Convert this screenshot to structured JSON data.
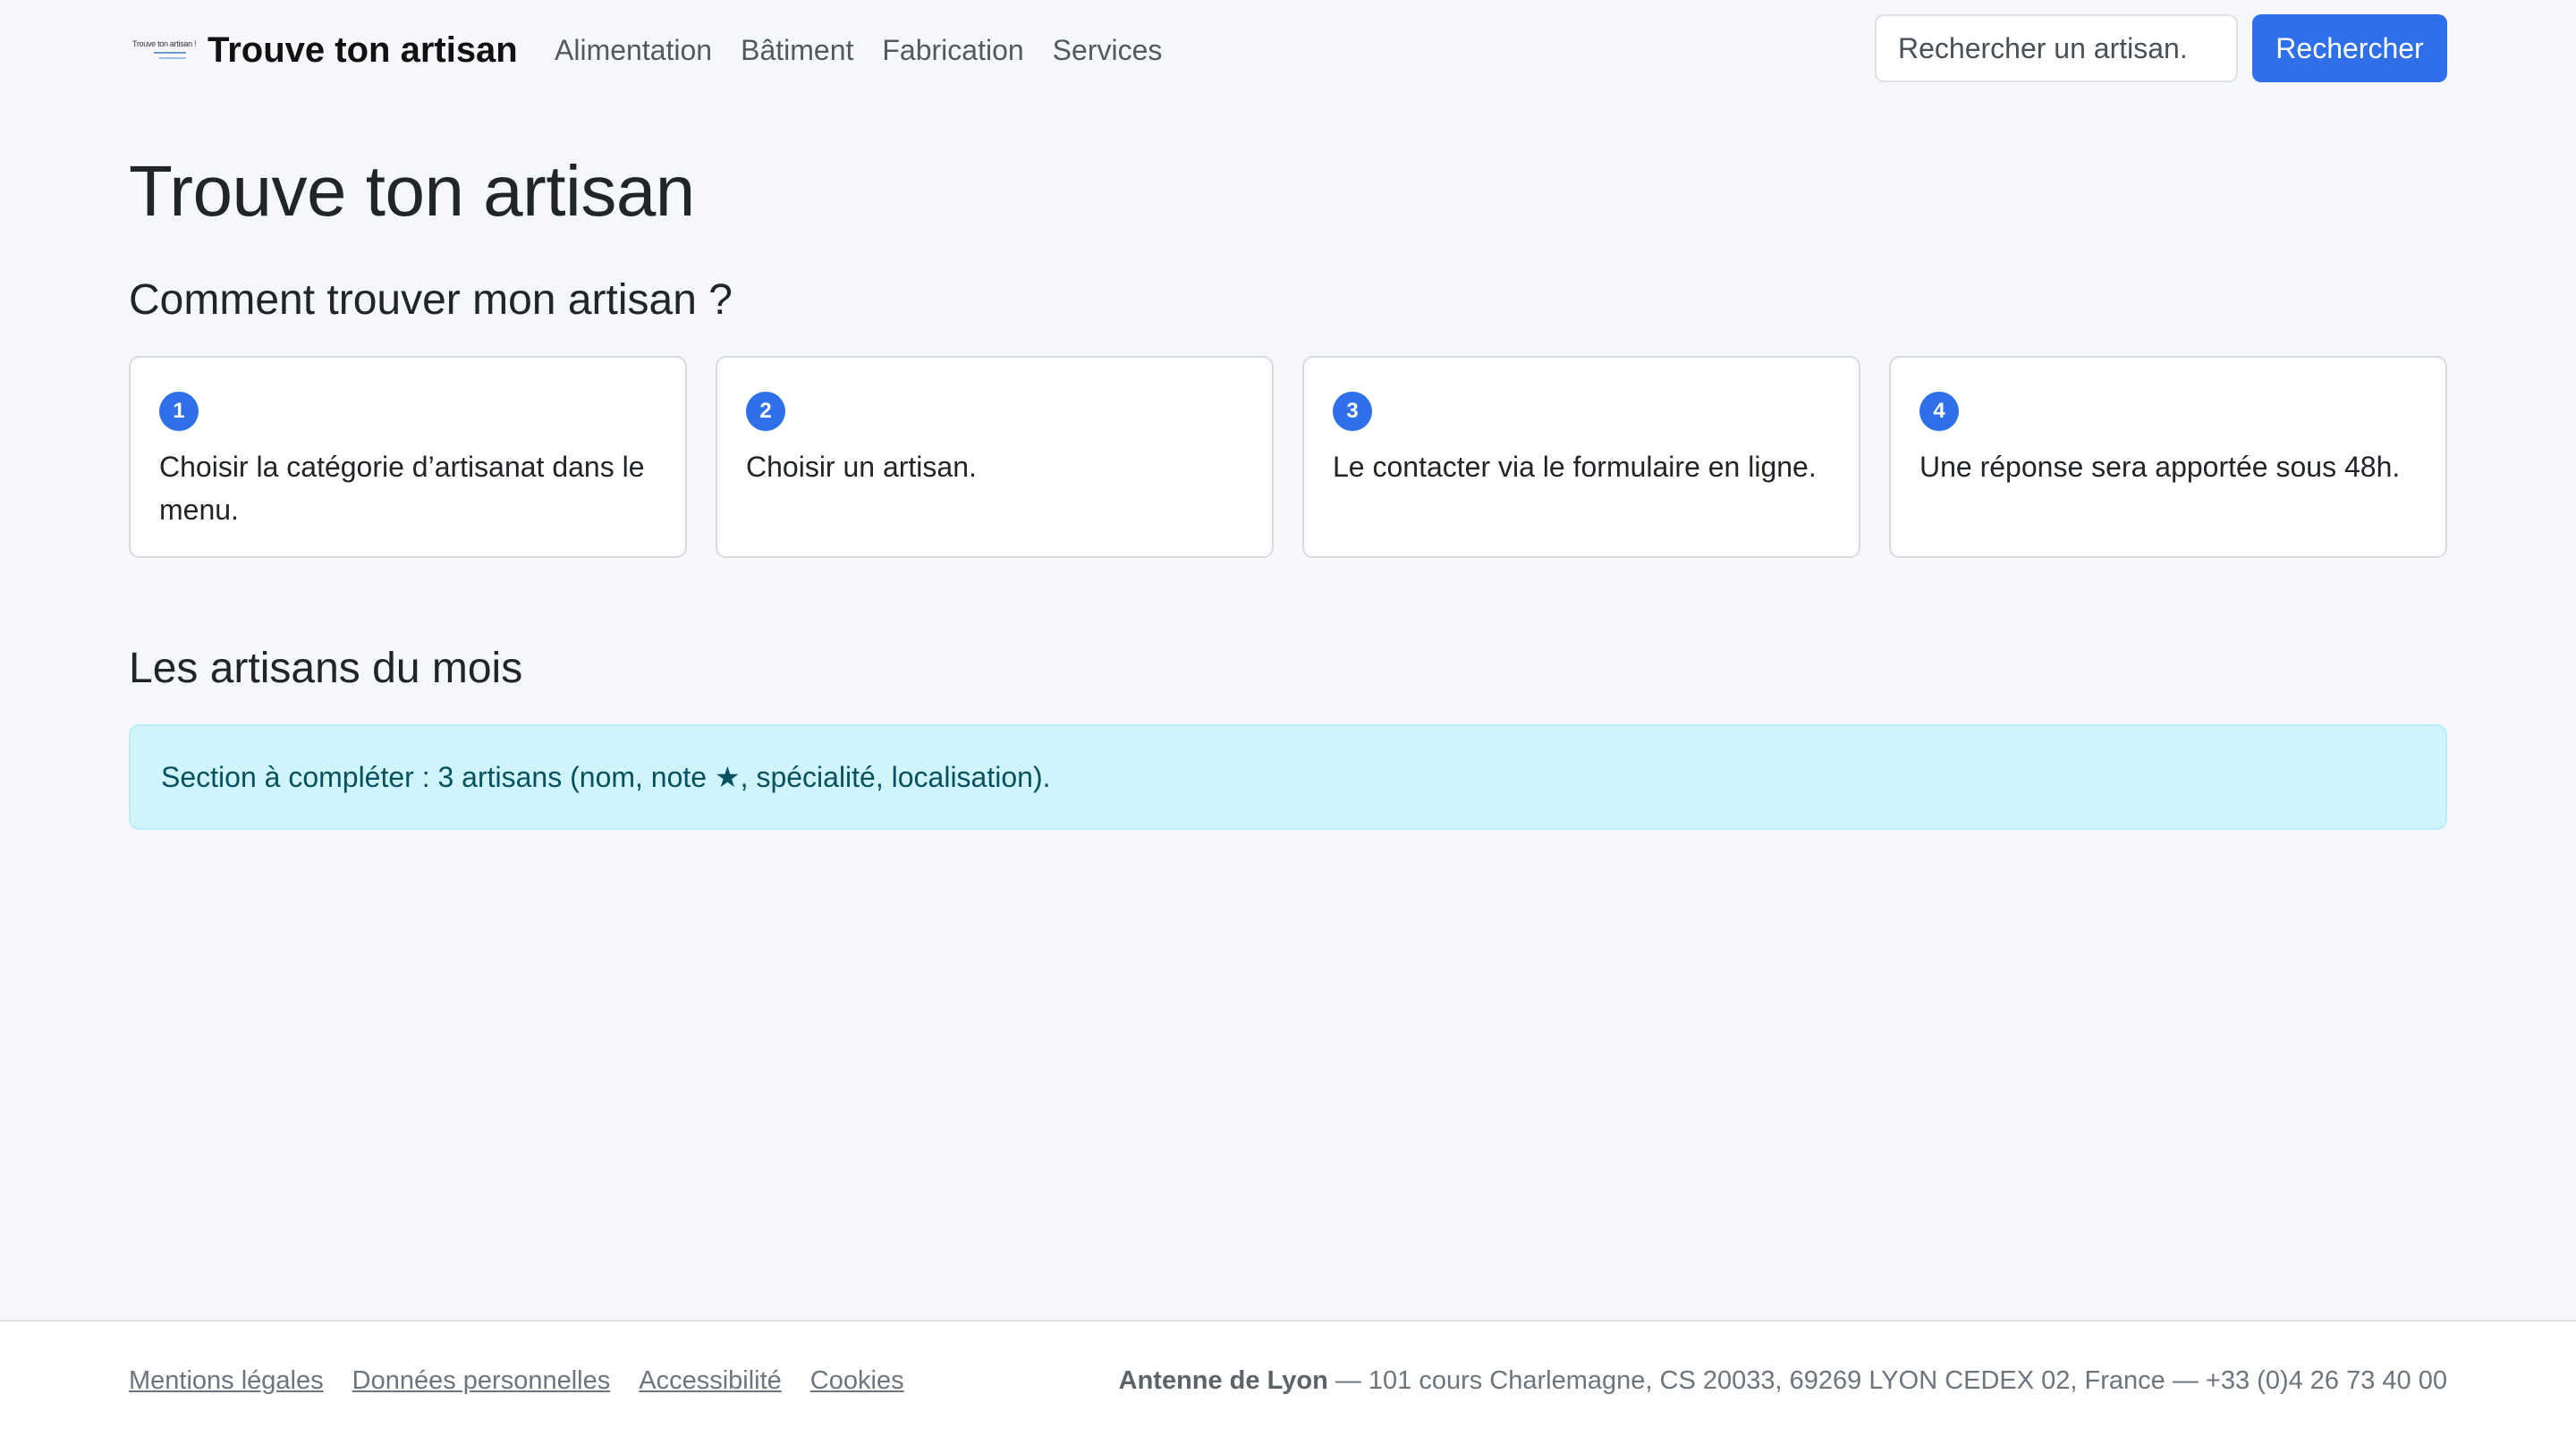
{
  "header": {
    "logo_text": "Trouve ton artisan !",
    "brand": "Trouve ton artisan",
    "nav": [
      "Alimentation",
      "Bâtiment",
      "Fabrication",
      "Services"
    ],
    "search_placeholder": "Rechercher un artisan.",
    "search_button": "Rechercher"
  },
  "main": {
    "title": "Trouve ton artisan",
    "how_title": "Comment trouver mon artisan ?",
    "steps": [
      {
        "number": "1",
        "text": "Choisir la catégorie d’artisanat dans le menu."
      },
      {
        "number": "2",
        "text": "Choisir un artisan."
      },
      {
        "number": "3",
        "text": "Le contacter via le formulaire en ligne."
      },
      {
        "number": "4",
        "text": "Une réponse sera apportée sous 48h."
      }
    ],
    "month_title": "Les artisans du mois",
    "alert": "Section à compléter : 3 artisans (nom, note ★, spécialité, localisation)."
  },
  "footer": {
    "links": [
      "Mentions légales",
      "Données personnelles",
      "Accessibilité",
      "Cookies"
    ],
    "office_name": "Antenne de Lyon",
    "office_details": " — 101 cours Charlemagne, CS 20033, 69269 LYON CEDEX 02, France — +33 (0)4 26 73 40 00"
  },
  "colors": {
    "accent": "#2f6fea",
    "page_bg": "#f5f7fb",
    "alert_bg": "#cff4fc"
  }
}
